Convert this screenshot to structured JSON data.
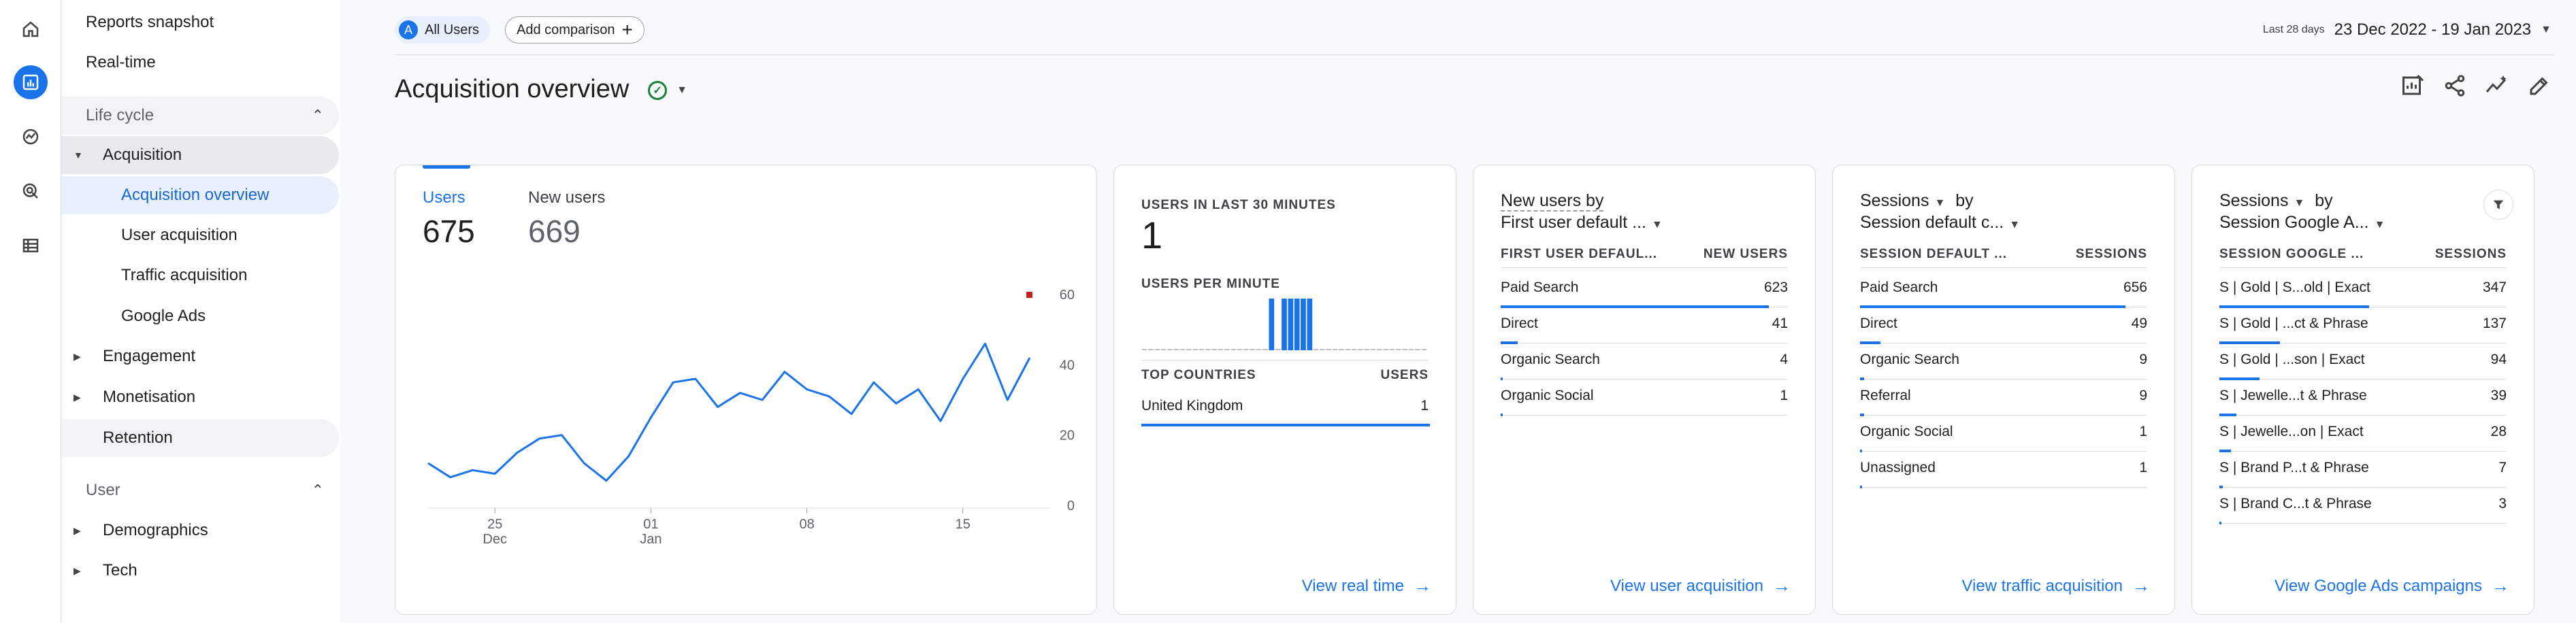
{
  "nav": {
    "reports_snapshot": "Reports snapshot",
    "realtime": "Real-time",
    "lifecycle": "Life cycle",
    "acquisition": "Acquisition",
    "acquisition_overview": "Acquisition overview",
    "user_acquisition": "User acquisition",
    "traffic_acquisition": "Traffic acquisition",
    "google_ads": "Google Ads",
    "engagement": "Engagement",
    "monetisation": "Monetisation",
    "retention": "Retention",
    "user": "User",
    "demographics": "Demographics",
    "tech": "Tech"
  },
  "header": {
    "all_users_badge": "A",
    "all_users": "All Users",
    "add_comparison": "Add comparison",
    "date_label": "Last 28 days",
    "date_value": "23 Dec 2022 - 19 Jan 2023",
    "title": "Acquisition overview"
  },
  "card_users": {
    "users_label": "Users",
    "users_value": "675",
    "new_users_label": "New users",
    "new_users_value": "669",
    "chart_data": {
      "type": "line",
      "x": [
        1,
        2,
        3,
        4,
        5,
        6,
        7,
        8,
        9,
        10,
        11,
        12,
        13,
        14,
        15,
        16,
        17,
        18,
        19,
        20,
        21,
        22,
        23,
        24,
        25,
        26,
        27,
        28
      ],
      "values": [
        12,
        8,
        10,
        9,
        15,
        19,
        20,
        12,
        7,
        14,
        25,
        35,
        36,
        28,
        32,
        30,
        38,
        33,
        31,
        26,
        35,
        29,
        33,
        24,
        36,
        46,
        30,
        42
      ],
      "ylim": [
        0,
        60
      ],
      "yticks": [
        "0",
        "20",
        "40",
        "60"
      ],
      "xticks": [
        {
          "i": 3,
          "label": "25",
          "sub": "Dec"
        },
        {
          "i": 10,
          "label": "01",
          "sub": "Jan"
        },
        {
          "i": 17,
          "label": "08",
          "sub": ""
        },
        {
          "i": 24,
          "label": "15",
          "sub": ""
        }
      ],
      "grid": false,
      "color": "#1a73e8",
      "marker_color": "#c5221f"
    }
  },
  "card_realtime": {
    "caption": "USERS IN LAST 30 MINUTES",
    "value": "1",
    "per_minute": "USERS PER MINUTE",
    "per_minute_bars": [
      0,
      0,
      0,
      0,
      0,
      0,
      0,
      0,
      0,
      0,
      0,
      0,
      0,
      0,
      0,
      0,
      0,
      0,
      0,
      0,
      1,
      0,
      1,
      1,
      1,
      1,
      1,
      0,
      0,
      0,
      0,
      0,
      0,
      0,
      0,
      0,
      0,
      0,
      0,
      0,
      0,
      0,
      0,
      0,
      0
    ],
    "top_countries": "TOP COUNTRIES",
    "users_col": "USERS",
    "rows": [
      {
        "label": "United Kingdom",
        "value": "1",
        "frac": 1.0
      }
    ],
    "link": "View real time"
  },
  "card_new_users": {
    "head1": "New users by",
    "head2": "First user default ...",
    "col1": "FIRST USER DEFAUL...",
    "col2": "NEW USERS",
    "rows": [
      {
        "label": "Paid Search",
        "value": "623",
        "frac": 0.93
      },
      {
        "label": "Direct",
        "value": "41",
        "frac": 0.06
      },
      {
        "label": "Organic Search",
        "value": "4",
        "frac": 0.006
      },
      {
        "label": "Organic Social",
        "value": "1",
        "frac": 0.002
      }
    ],
    "link": "View user acquisition"
  },
  "card_sessions": {
    "head1": "Sessions",
    "head_by": "by",
    "head2": "Session default c...",
    "col1": "SESSION DEFAULT ...",
    "col2": "SESSIONS",
    "rows": [
      {
        "label": "Paid Search",
        "value": "656",
        "frac": 0.92
      },
      {
        "label": "Direct",
        "value": "49",
        "frac": 0.07
      },
      {
        "label": "Organic Search",
        "value": "9",
        "frac": 0.013
      },
      {
        "label": "Referral",
        "value": "9",
        "frac": 0.013
      },
      {
        "label": "Organic Social",
        "value": "1",
        "frac": 0.002
      },
      {
        "label": "Unassigned",
        "value": "1",
        "frac": 0.002
      }
    ],
    "link": "View traffic acquisition"
  },
  "card_ads": {
    "head1": "Sessions",
    "head_by": "by",
    "head2": "Session Google A...",
    "col1": "SESSION GOOGLE ...",
    "col2": "SESSIONS",
    "rows": [
      {
        "label": "S | Gold | S...old | Exact",
        "value": "347",
        "frac": 0.52
      },
      {
        "label": "S | Gold | ...ct & Phrase",
        "value": "137",
        "frac": 0.21
      },
      {
        "label": "S | Gold | ...son | Exact",
        "value": "94",
        "frac": 0.14
      },
      {
        "label": "S | Jewelle...t & Phrase",
        "value": "39",
        "frac": 0.06
      },
      {
        "label": "S | Jewelle...on | Exact",
        "value": "28",
        "frac": 0.04
      },
      {
        "label": "S | Brand P...t & Phrase",
        "value": "7",
        "frac": 0.011
      },
      {
        "label": "S | Brand C...t & Phrase",
        "value": "3",
        "frac": 0.005
      }
    ],
    "link": "View Google Ads campaigns"
  }
}
